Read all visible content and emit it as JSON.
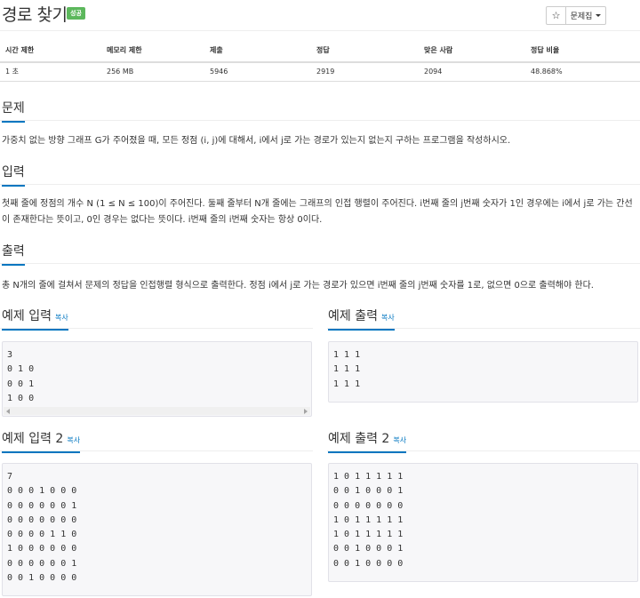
{
  "header": {
    "title": "경로 찾기",
    "badge": "성공",
    "star_icon": "☆",
    "problemset_label": "문제집"
  },
  "info_table": {
    "headers": [
      "시간 제한",
      "메모리 제한",
      "제출",
      "정답",
      "맞은 사람",
      "정답 비율"
    ],
    "values": [
      "1 초",
      "256 MB",
      "5946",
      "2919",
      "2094",
      "48.868%"
    ]
  },
  "problem": {
    "heading": "문제",
    "text": "가중치 없는 방향 그래프 G가 주어졌을 때, 모든 정점 (i, j)에 대해서, i에서 j로 가는 경로가 있는지 없는지 구하는 프로그램을 작성하시오."
  },
  "input": {
    "heading": "입력",
    "text": "첫째 줄에 정점의 개수 N (1 ≤ N ≤ 100)이 주어진다. 둘째 줄부터 N개 줄에는 그래프의 인접 행렬이 주어진다. i번째 줄의 j번째 숫자가 1인 경우에는 i에서 j로 가는 간선이 존재한다는 뜻이고, 0인 경우는 없다는 뜻이다. i번째 줄의 i번째 숫자는 항상 0이다."
  },
  "output": {
    "heading": "출력",
    "text": "총 N개의 줄에 걸쳐서 문제의 정답을 인접행렬 형식으로 출력한다. 정점 i에서 j로 가는 경로가 있으면 i번째 줄의 j번째 숫자를 1로, 없으면 0으로 출력해야 한다."
  },
  "samples": {
    "copy_label": "복사",
    "input1": {
      "heading": "예제 입력",
      "content": "3\n0 1 0\n0 0 1\n1 0 0"
    },
    "output1": {
      "heading": "예제 출력",
      "content": "1 1 1\n1 1 1\n1 1 1"
    },
    "input2": {
      "heading": "예제 입력 2",
      "content": "7\n0 0 0 1 0 0 0\n0 0 0 0 0 0 1\n0 0 0 0 0 0 0\n0 0 0 0 1 1 0\n1 0 0 0 0 0 0\n0 0 0 0 0 0 1\n0 0 1 0 0 0 0"
    },
    "output2": {
      "heading": "예제 출력 2",
      "content": "1 0 1 1 1 1 1\n0 0 1 0 0 0 1\n0 0 0 0 0 0 0\n1 0 1 1 1 1 1\n1 0 1 1 1 1 1\n0 0 1 0 0 0 1\n0 0 1 0 0 0 0"
    }
  },
  "colors": {
    "accent": "#0076c0",
    "badge_success": "#5cb85c"
  }
}
